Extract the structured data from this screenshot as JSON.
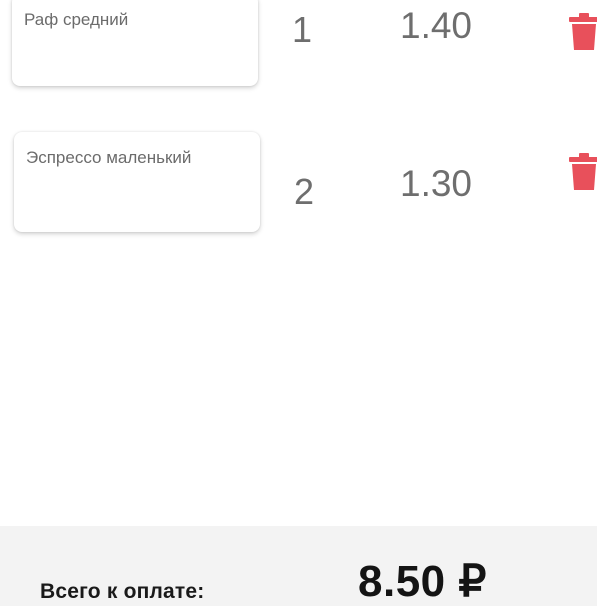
{
  "cart": {
    "items": [
      {
        "name": "Раф средний",
        "quantity": "1",
        "price": "1.40"
      },
      {
        "name": "Эспрессо маленький",
        "quantity": "2",
        "price": "1.30"
      }
    ]
  },
  "footer": {
    "total_label": "Всего к оплате:",
    "total_value": "8.50 ₽"
  },
  "icons": {
    "delete": "trash-icon"
  },
  "colors": {
    "delete_icon": "#e8505b",
    "footer_bg": "#f3f3f3"
  }
}
